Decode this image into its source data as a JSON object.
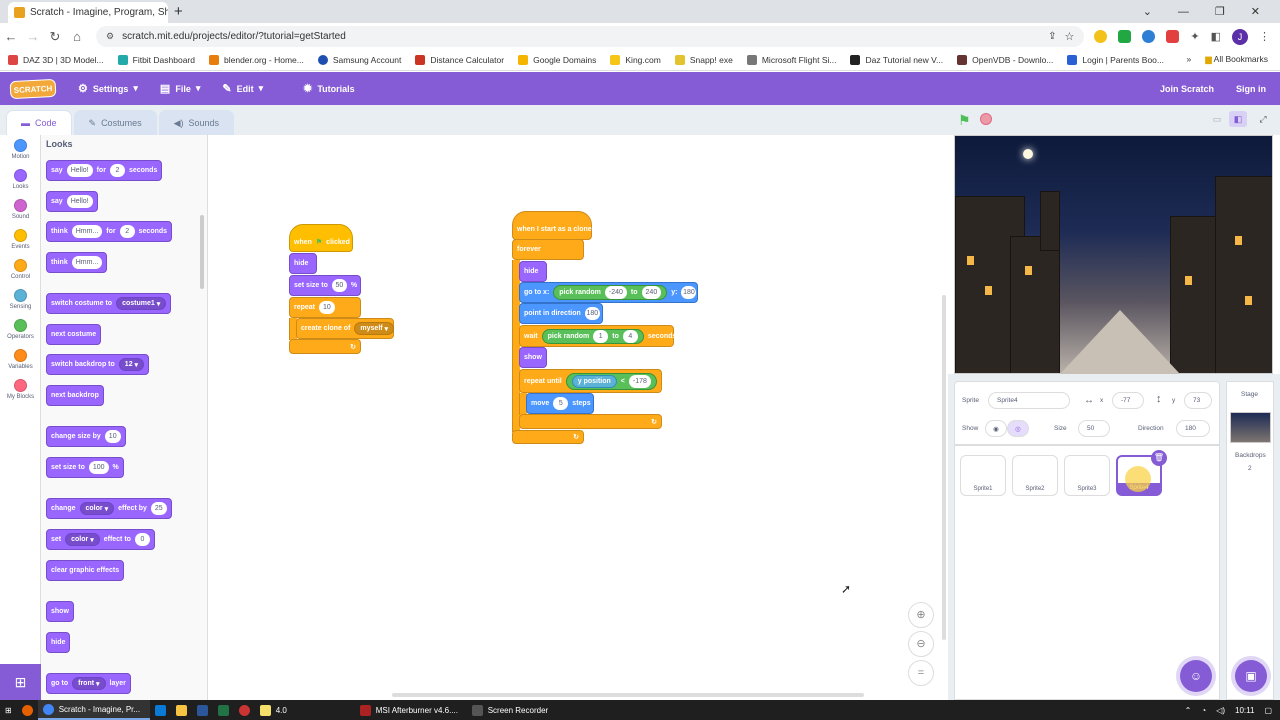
{
  "browser": {
    "tab_title": "Scratch - Imagine, Program, Sh",
    "new_tab": "+",
    "url": "scratch.mit.edu/projects/editor/?tutorial=getStarted",
    "profile_initial": "J",
    "bookmarks": [
      "DAZ 3D | 3D Model...",
      "Fitbit Dashboard",
      "blender.org - Home...",
      "Samsung Account",
      "Distance Calculator",
      "Google Domains",
      "King.com",
      "Snapp! exe",
      "Microsoft Flight Si...",
      "Daz Tutorial new V...",
      "OpenVDB - Downlo...",
      "Login | Parents Boo..."
    ],
    "bookmarks_more": "»",
    "all_bookmarks": "All Bookmarks"
  },
  "menu": {
    "logo": "SCRATCH",
    "settings": "Settings",
    "file": "File",
    "edit": "Edit",
    "tutorials": "Tutorials",
    "join": "Join Scratch",
    "signin": "Sign in"
  },
  "tabs": {
    "code": "Code",
    "costumes": "Costumes",
    "sounds": "Sounds"
  },
  "categories": [
    {
      "label": "Motion",
      "color": "#4c97ff"
    },
    {
      "label": "Looks",
      "color": "#9966ff"
    },
    {
      "label": "Sound",
      "color": "#cf63cf"
    },
    {
      "label": "Events",
      "color": "#ffbf00"
    },
    {
      "label": "Control",
      "color": "#ffab19"
    },
    {
      "label": "Sensing",
      "color": "#5cb1d6"
    },
    {
      "label": "Operators",
      "color": "#59c059"
    },
    {
      "label": "Variables",
      "color": "#ff8c1a"
    },
    {
      "label": "My Blocks",
      "color": "#ff6680"
    }
  ],
  "palette": {
    "title": "Looks",
    "say": "say",
    "hello": "Hello!",
    "for": "for",
    "two": "2",
    "seconds": "seconds",
    "think": "think",
    "hmm": "Hmm...",
    "switch_costume": "switch costume to",
    "costume1": "costume1",
    "next_costume": "next costume",
    "switch_backdrop": "switch backdrop to",
    "bd12": "12",
    "next_backdrop": "next backdrop",
    "change_size": "change size by",
    "ten": "10",
    "set_size": "set size to",
    "hundred": "100",
    "pct": "%",
    "change": "change",
    "color": "color",
    "effect_by": "effect by",
    "twentyfive": "25",
    "set": "set",
    "effect_to": "effect to",
    "zero": "0",
    "clear_effects": "clear graphic effects",
    "show": "show",
    "hide": "hide",
    "go_to": "go to",
    "front": "front",
    "layer": "layer"
  },
  "script1": {
    "when": "when",
    "clicked": "clicked",
    "hide": "hide",
    "set_size": "set size to",
    "size_val": "50",
    "pct": "%",
    "repeat": "repeat",
    "repeat_val": "10",
    "create_clone": "create clone of",
    "myself": "myself"
  },
  "script2": {
    "hat": "when I start as a clone",
    "forever": "forever",
    "hide": "hide",
    "goto": "go to x:",
    "pick_random": "pick random",
    "to": "to",
    "min_x": "-240",
    "max_x": "240",
    "y": "y:",
    "y_val": "180",
    "point": "point in direction",
    "dir_val": "180",
    "wait": "wait",
    "wait_min": "1",
    "wait_max": "4",
    "seconds": "seconds",
    "show": "show",
    "repeat_until": "repeat until",
    "y_position": "y position",
    "lt": "<",
    "limit": "-178",
    "move": "move",
    "steps_val": "5",
    "steps": "steps"
  },
  "sprite_info": {
    "sprite_label": "Sprite",
    "sprite_name": "Sprite4",
    "x_label": "x",
    "x_val": "-77",
    "y_label": "y",
    "y_val": "73",
    "show_label": "Show",
    "size_label": "Size",
    "size_val": "50",
    "direction_label": "Direction",
    "direction_val": "180"
  },
  "sprites": [
    "Sprite1",
    "Sprite2",
    "Sprite3",
    "Sprite4"
  ],
  "stage_col": {
    "title": "Stage",
    "backdrops_label": "Backdrops",
    "backdrops_count": "2"
  },
  "taskbar": {
    "chrome": "Scratch - Imagine, Pr...",
    "notes": "4.0",
    "afterburner": "MSI Afterburner v4.6....",
    "recorder": "Screen Recorder",
    "time": "10:11"
  }
}
